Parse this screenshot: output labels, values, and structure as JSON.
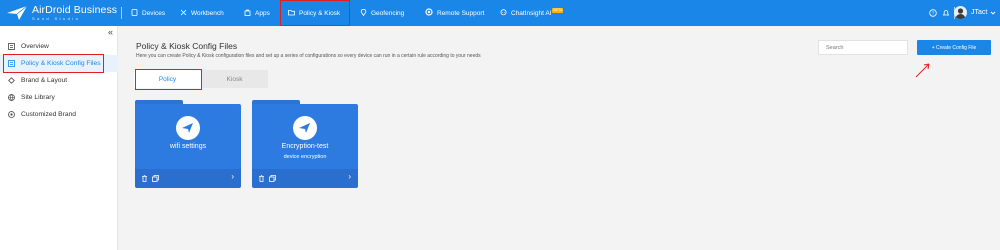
{
  "brand": {
    "name": "AirDroid Business",
    "sub": "Sand Studio"
  },
  "nav": {
    "items": [
      {
        "label": "Devices",
        "icon": "monitor-icon"
      },
      {
        "label": "Workbench",
        "icon": "tools-icon"
      },
      {
        "label": "Apps",
        "icon": "bag-icon"
      },
      {
        "label": "Policy & Kiosk",
        "icon": "folder-icon",
        "active": true
      },
      {
        "label": "Geofencing",
        "icon": "location-icon"
      },
      {
        "label": "Remote Support",
        "icon": "support-icon"
      },
      {
        "label": "ChatInsight AI",
        "icon": "chat-icon",
        "badge": "BETA"
      }
    ]
  },
  "user": {
    "name": "JTact"
  },
  "sidebar": {
    "items": [
      {
        "label": "Overview",
        "icon": "overview-icon"
      },
      {
        "label": "Policy & Kiosk Config Files",
        "icon": "config-files-icon",
        "active": true
      },
      {
        "label": "Brand & Layout",
        "icon": "brand-icon"
      },
      {
        "label": "Site Library",
        "icon": "globe-icon"
      },
      {
        "label": "Customized Brand",
        "icon": "settings-icon"
      }
    ]
  },
  "page": {
    "title": "Policy & Kiosk Config Files",
    "description": "Here you can create Policy & Kiosk configuration files and set up a series of configurations so every device can run in a certain rule according to your needs"
  },
  "search": {
    "placeholder": "Search"
  },
  "create_button": "+ Create Config File",
  "tabs": [
    {
      "label": "Policy",
      "active": true
    },
    {
      "label": "Kiosk",
      "active": false
    }
  ],
  "cards": [
    {
      "name": "wifi settings",
      "subtitle": ""
    },
    {
      "name": "Encryption-test",
      "subtitle": "device encryption"
    }
  ],
  "colors": {
    "primary": "#1a87e8",
    "card": "#2d7be0",
    "highlight": "#e02020"
  }
}
